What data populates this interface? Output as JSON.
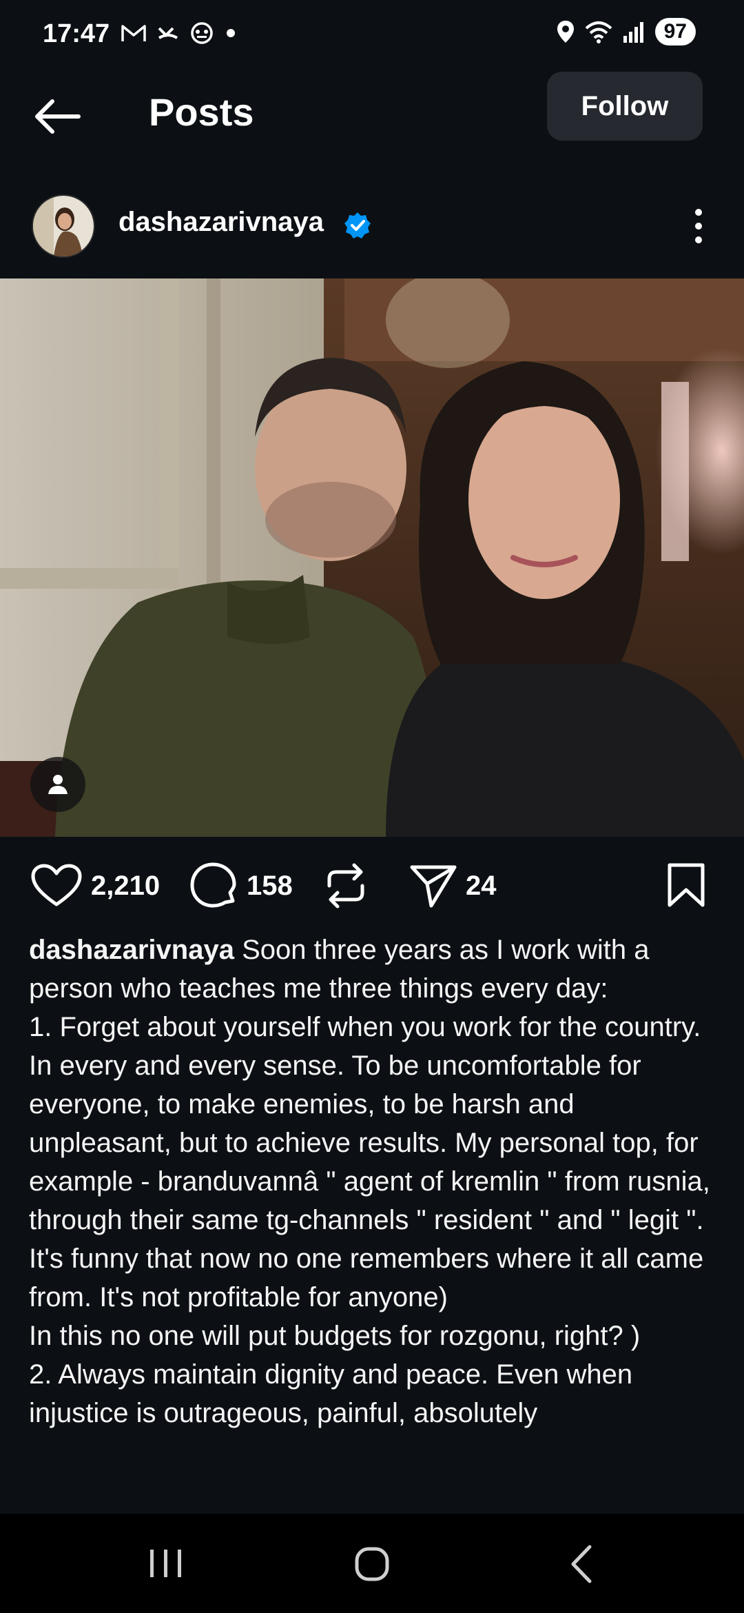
{
  "status_bar": {
    "time": "17:47",
    "battery": "97",
    "left_icons": [
      "gmail-icon",
      "missed-call-icon",
      "game-controller-icon",
      "dot-icon"
    ],
    "right_icons": [
      "location-icon",
      "wifi-icon",
      "signal-icon"
    ]
  },
  "header": {
    "title": "Posts",
    "follow_label": "Follow"
  },
  "post": {
    "username": "dashazarivnaya",
    "verified": true,
    "likes": "2,210",
    "comments": "158",
    "shares": "24",
    "caption_user": "dashazarivnaya",
    "caption_text": " Soon three years as I work with a person who teaches me three things every day:\n1. Forget about yourself when you work for the country.\nIn every and every sense. To be uncomfortable for everyone, to make enemies, to be harsh and unpleasant, but to achieve results. My personal top, for example - branduvannâ \" agent of kremlin \" from rusnia, through their same tg-channels \" resident \" and \" legit \".\nIt's funny that now no one remembers where it all came from. It's not profitable for anyone)\nIn this no one will put budgets for rozgonu, right? )\n2. Always maintain dignity and peace. Even when injustice is outrageous, painful, absolutely"
  },
  "colors": {
    "background": "#0c1014",
    "follow_button": "#262a30",
    "verified_badge": "#0095f6"
  }
}
